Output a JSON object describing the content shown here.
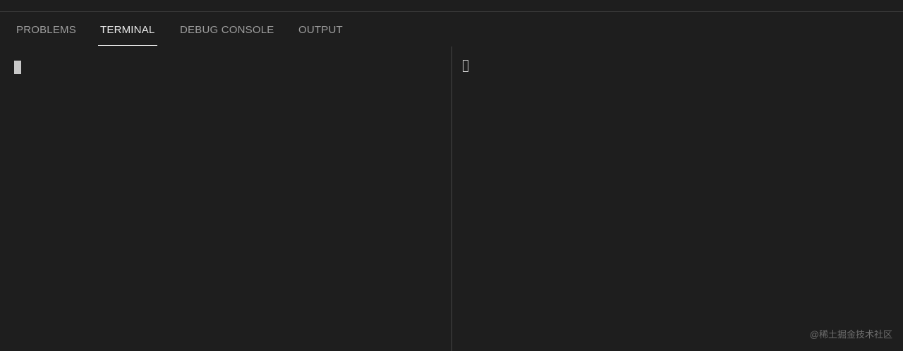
{
  "panel": {
    "tabs": [
      {
        "label": "PROBLEMS",
        "active": false
      },
      {
        "label": "TERMINAL",
        "active": true
      },
      {
        "label": "DEBUG CONSOLE",
        "active": false
      },
      {
        "label": "OUTPUT",
        "active": false
      }
    ]
  },
  "watermark": "@稀土掘金技术社区",
  "colors": {
    "background": "#1e1e1e",
    "tab_inactive": "#9d9d9d",
    "tab_active": "#e7e7e7",
    "divider": "#454545"
  }
}
